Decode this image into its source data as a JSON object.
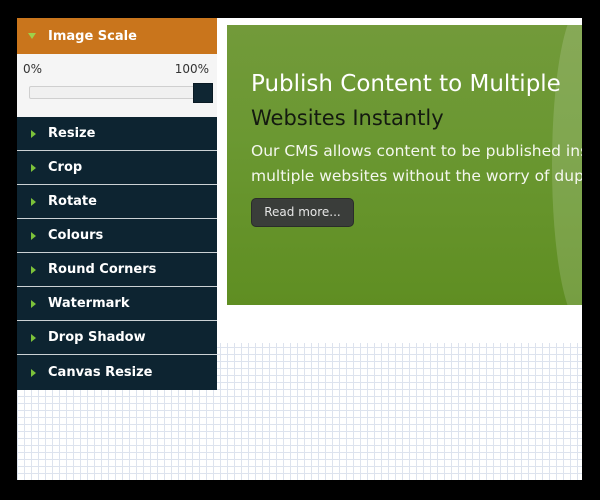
{
  "panel": {
    "header_label": "Image Scale",
    "scale": {
      "min_label": "0%",
      "max_label": "100%",
      "value_percent": 100
    },
    "items": [
      {
        "label": "Resize"
      },
      {
        "label": "Crop"
      },
      {
        "label": "Rotate"
      },
      {
        "label": "Colours"
      },
      {
        "label": "Round Corners"
      },
      {
        "label": "Watermark"
      },
      {
        "label": "Drop Shadow"
      },
      {
        "label": "Canvas Resize"
      }
    ]
  },
  "banner": {
    "title_line1": "Publish Content to Multiple",
    "title_line2": "Websites Instantly",
    "desc_line1": "Our CMS allows content to be published instan",
    "desc_line2": "multiple websites without the worry of duplica",
    "button_label": "Read more..."
  },
  "colors": {
    "accent_orange": "#c9751c",
    "menu_dark": "#0d2431",
    "banner_green": "#6b9832",
    "triangle_green": "#7cc23a"
  }
}
